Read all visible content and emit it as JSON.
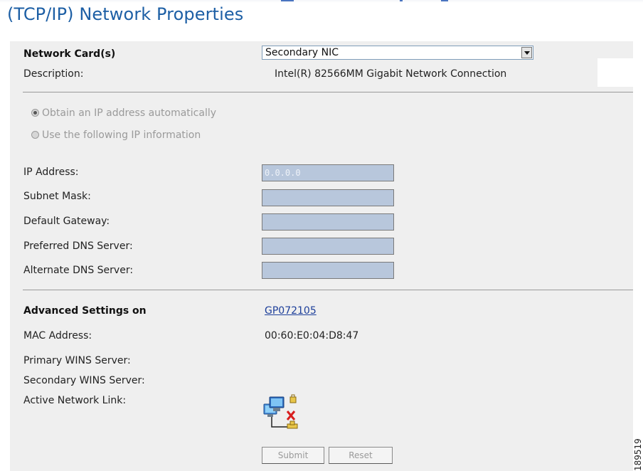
{
  "page": {
    "title": "(TCP/IP) Network Properties"
  },
  "network_card": {
    "label": "Network Card(s)",
    "selected": "Secondary NIC",
    "description_label": "Description:",
    "description_value": "Intel(R) 82566MM Gigabit Network Connection"
  },
  "ip_mode": {
    "options": [
      {
        "label": "Obtain an IP address automatically",
        "selected": true
      },
      {
        "label": "Use the following IP information",
        "selected": false
      }
    ]
  },
  "ip_fields": [
    {
      "label": "IP Address:",
      "value": "0.0.0.0"
    },
    {
      "label": "Subnet Mask:",
      "value": ""
    },
    {
      "label": "Default Gateway:",
      "value": ""
    },
    {
      "label": "Preferred DNS Server:",
      "value": ""
    },
    {
      "label": "Alternate DNS Server:",
      "value": ""
    }
  ],
  "advanced": {
    "label": "Advanced Settings on",
    "host_link": "GP072105",
    "mac_label": "MAC Address:",
    "mac_value": "00:60:E0:04:D8:47",
    "primary_wins_label": "Primary WINS Server:",
    "secondary_wins_label": "Secondary WINS Server:",
    "active_link_label": "Active Network Link:"
  },
  "buttons": {
    "submit": "Submit",
    "reset": "Reset"
  },
  "watermark": "189519",
  "icons": {
    "network_status": "network-disconnected-icon"
  },
  "colors": {
    "title": "#1d5fa5",
    "panel": "#efefef",
    "field": "#b8c7dc",
    "link": "#1d3f9a"
  }
}
